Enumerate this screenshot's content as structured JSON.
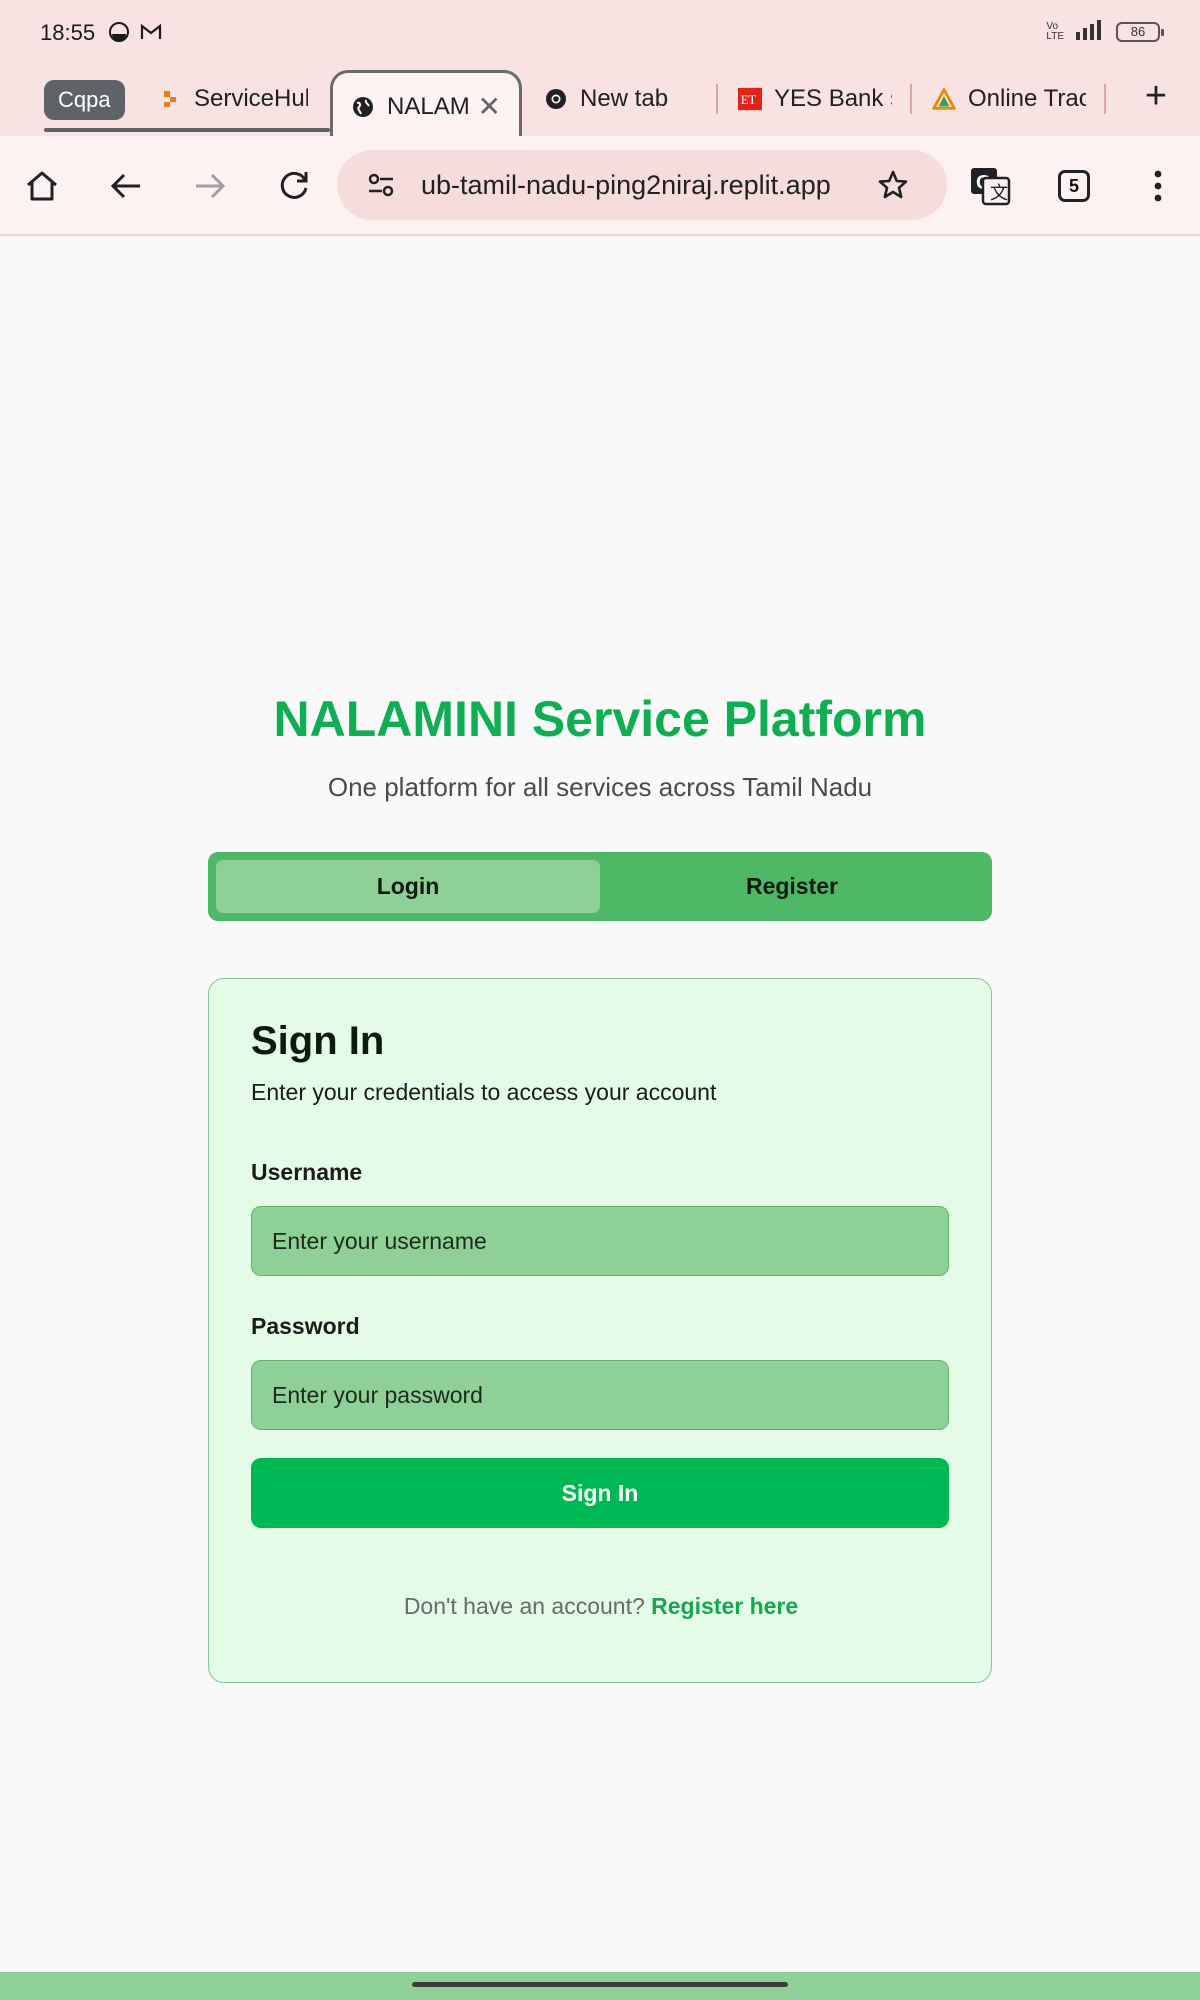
{
  "status_bar": {
    "time": "18:55",
    "battery": "86",
    "signal_text": "Vo LTE 4G R",
    "icons": [
      "do-not-disturb-icon",
      "gmail-icon",
      "volte-icon",
      "signal-icon",
      "battery-icon"
    ]
  },
  "tab_strip": {
    "group_label": "Cqpa",
    "tabs": [
      {
        "label": "ServiceHub",
        "icon": "servicehub-favicon"
      },
      {
        "label": "NALAMINI Service Platform",
        "icon": "globe-icon",
        "active": true
      },
      {
        "label": "New tab",
        "icon": "chrome-icon"
      },
      {
        "label": "YES Bank s",
        "icon": "et-favicon"
      },
      {
        "label": "Online Trac",
        "icon": "triangle-favicon"
      }
    ],
    "new_tab": "+"
  },
  "toolbar": {
    "url": "ub-tamil-nadu-ping2niraj.replit.app",
    "tab_count": "5",
    "icons": [
      "home-icon",
      "back-icon",
      "forward-icon",
      "reload-icon",
      "site-settings-icon",
      "bookmark-star-icon",
      "translate-icon",
      "tab-switcher-icon",
      "more-menu-icon"
    ]
  },
  "page": {
    "title": "NALAMINI Service Platform",
    "subtitle": "One platform for all services across Tamil Nadu",
    "tabs": {
      "login": "Login",
      "register": "Register",
      "active": "login"
    },
    "card": {
      "title": "Sign In",
      "description": "Enter your credentials to access your account",
      "username_label": "Username",
      "username_placeholder": "Enter your username",
      "password_label": "Password",
      "password_placeholder": "Enter your password",
      "submit_label": "Sign In",
      "footer_text": "Don't have an account?",
      "footer_link": "Register here"
    }
  },
  "colors": {
    "title_green": "#0fae52",
    "button_green": "#00b853",
    "segment_green": "#4fb867",
    "card_bg": "#e4fce7",
    "chrome_bg": "#f8e2e2"
  }
}
